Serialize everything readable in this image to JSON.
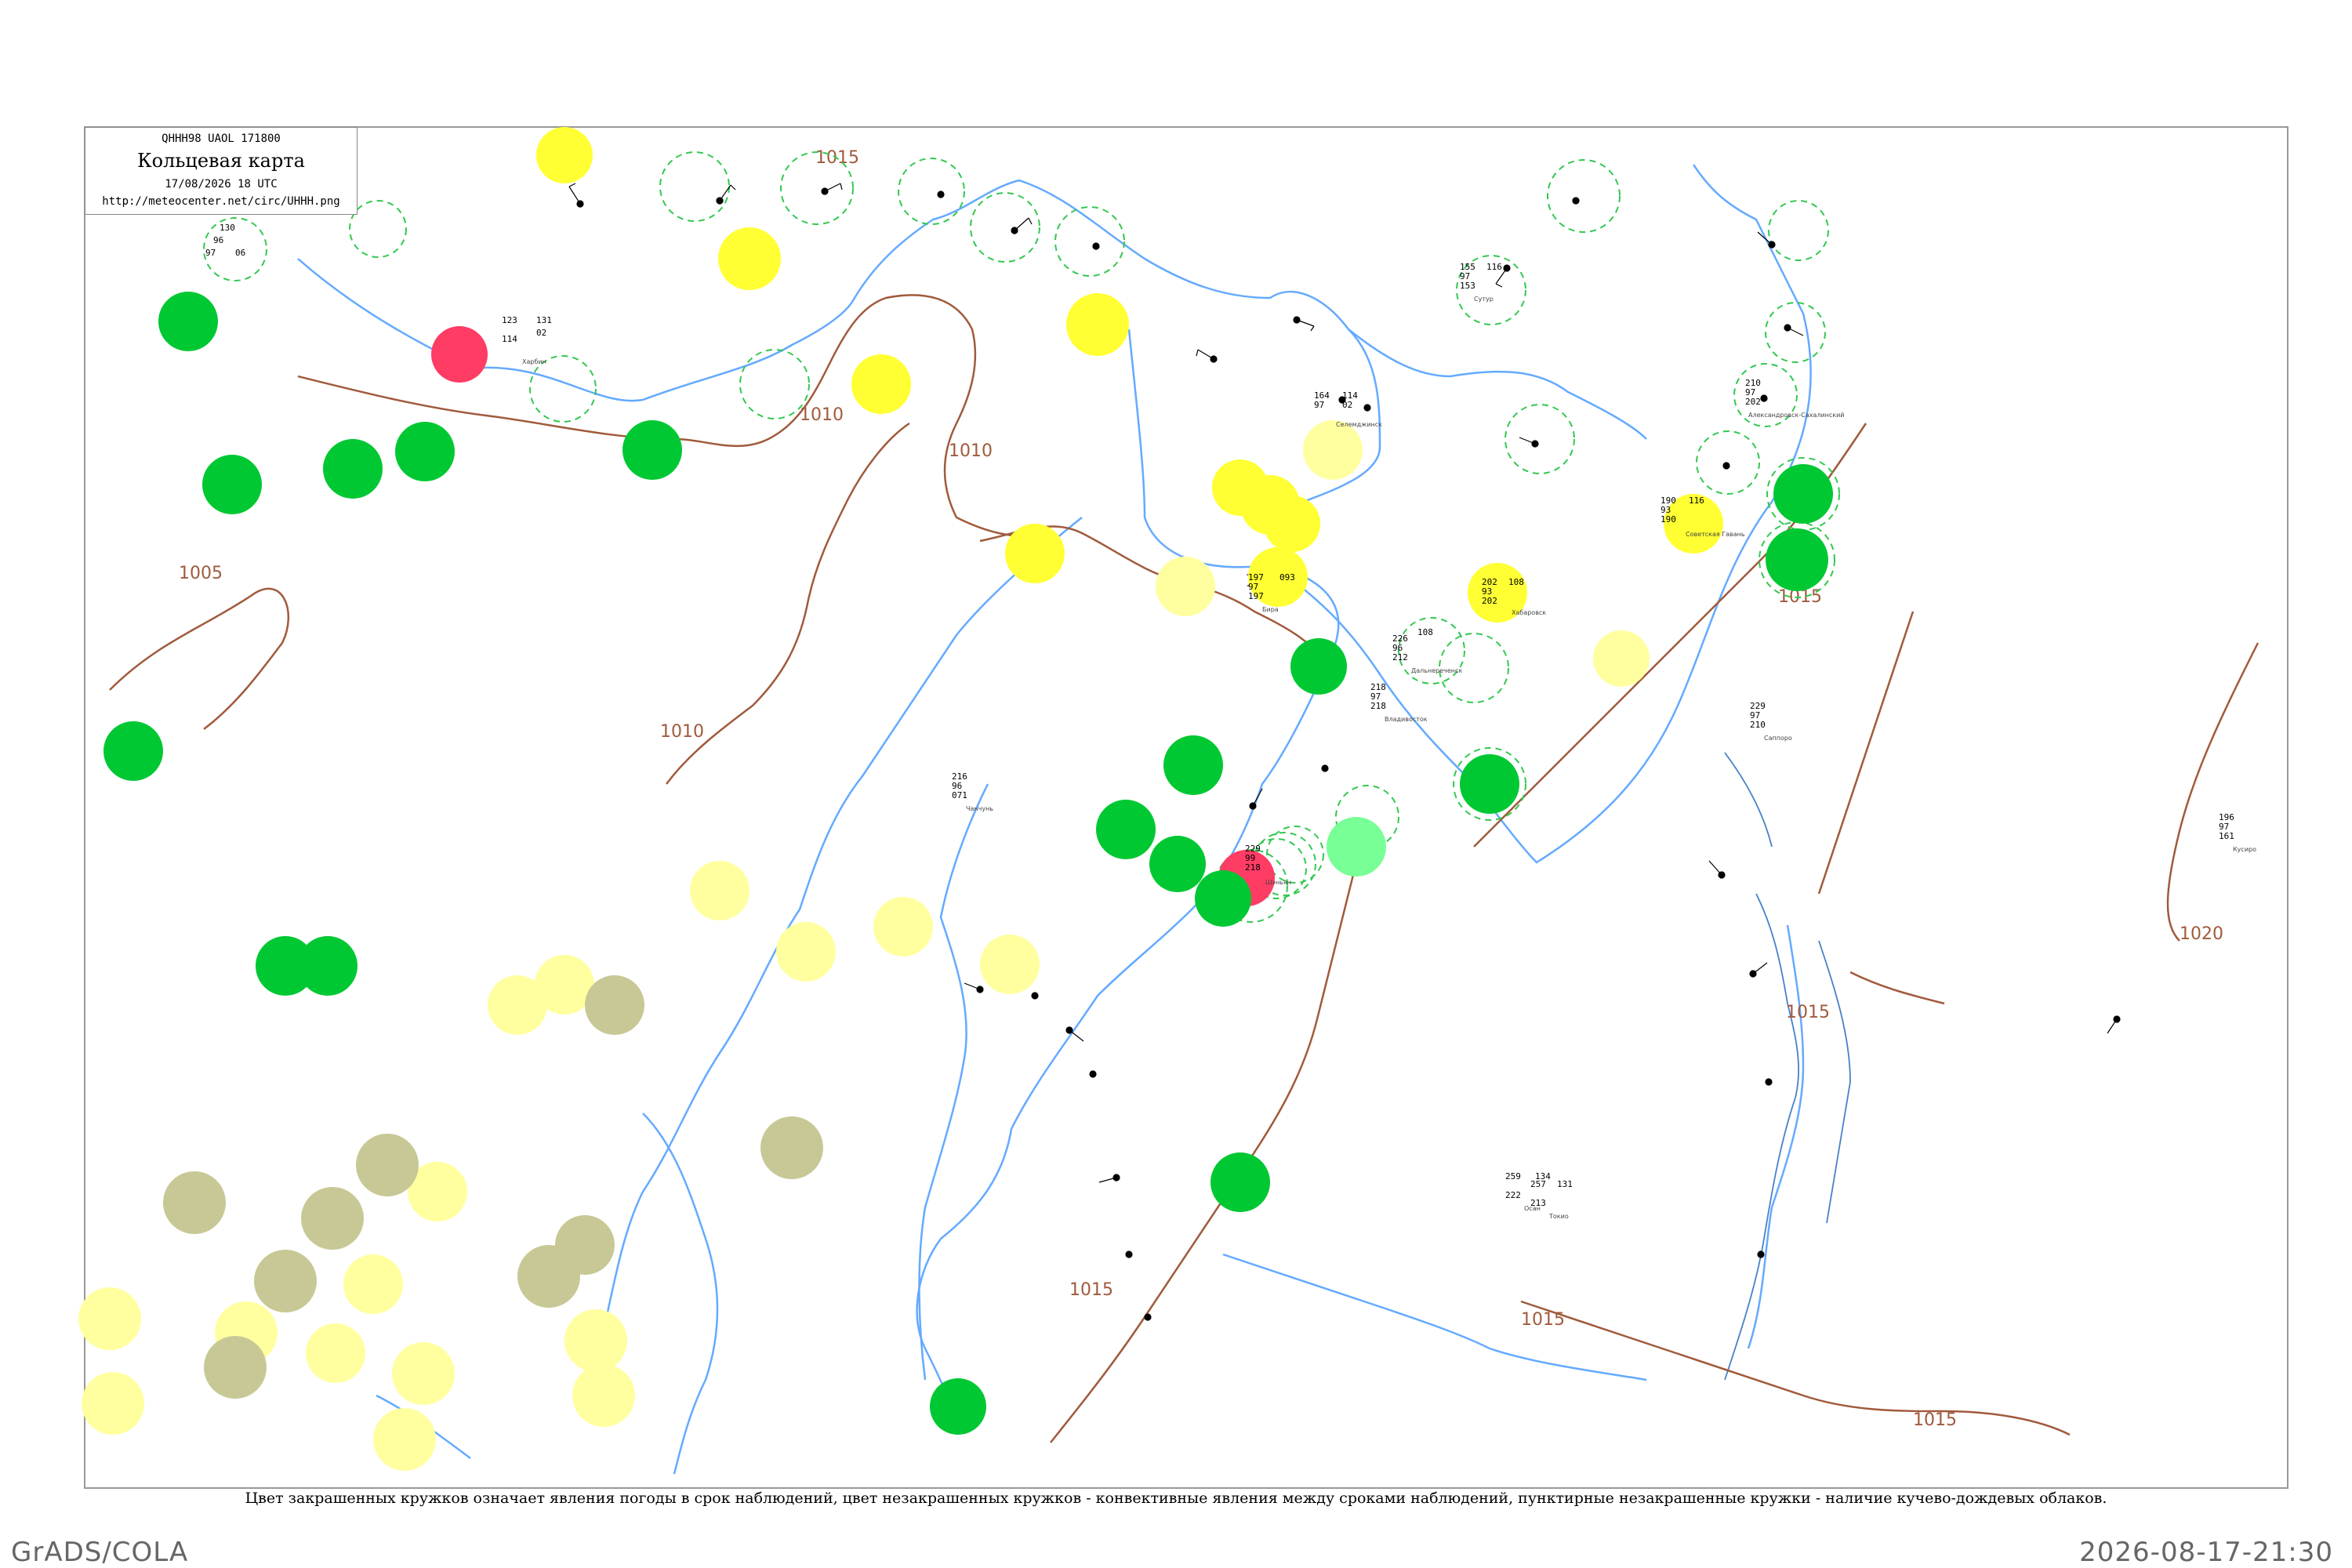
{
  "header": {
    "code": "QHHH98  UAOL  171800",
    "title": "Кольцевая карта",
    "date": "17/08/2026 18 UTC",
    "url": "http://meteocenter.net/circ/UHHH.png"
  },
  "caption": "Цвет закрашенных кружков означает явления погоды в срок наблюдений, цвет незакрашенных кружков - конвективные явления между сроками наблюдений, пунктирные незакрашенные кружки - наличие кучево-дождевых облаков.",
  "footer": {
    "left": "GrADS/COLA",
    "right": "2026-08-17-21:30"
  },
  "colors": {
    "green": "#00c832",
    "yellow": "#ffff33",
    "pale_yellow": "#ffffa0",
    "olive": "#c8c896",
    "red": "#ff3c64",
    "light_green": "#78ff96",
    "isobar": "#a05a3c",
    "river": "#64aaff",
    "dashed_circle": "#32c850"
  },
  "isobars": [
    "1015",
    "1010",
    "1010",
    "1010",
    "1005",
    "1010",
    "1015",
    "1020",
    "1015",
    "1015",
    "1015",
    "1015"
  ],
  "stations": [
    {
      "id": "50834",
      "name": "",
      "vals": [
        "130",
        "97",
        "96",
        "06"
      ]
    },
    {
      "id": "50953",
      "name": "Харбин",
      "vals": [
        "123",
        "114",
        "131",
        "02"
      ]
    },
    {
      "id": "31532",
      "name": "Селемджинск",
      "vals": [
        "164",
        "97",
        "114",
        "02"
      ]
    },
    {
      "id": "31707",
      "name": "Бира",
      "vals": [
        "197",
        "093",
        "97",
        "197"
      ]
    },
    {
      "id": "31735",
      "name": "Хабаровск",
      "vals": [
        "202",
        "93",
        "108",
        "202"
      ]
    },
    {
      "id": "31770",
      "name": "Советская Гавань",
      "vals": [
        "190",
        "93",
        "116",
        "190"
      ]
    },
    {
      "id": "32061",
      "name": "Александровск-Сахалинский",
      "vals": [
        "210",
        "97",
        "202"
      ]
    },
    {
      "id": "47412",
      "name": "Саппоро",
      "vals": [
        "229",
        "97",
        "210"
      ]
    },
    {
      "id": "54342",
      "name": "Шэньян",
      "vals": [
        "229",
        "99",
        "218"
      ]
    },
    {
      "id": "47122",
      "name": "Осан",
      "vals": [
        "259",
        "134",
        "222"
      ]
    },
    {
      "id": "47420",
      "name": "Кусиро",
      "vals": [
        "196",
        "97",
        "161"
      ]
    },
    {
      "id": "31538",
      "name": "Сутур",
      "vals": [
        "155",
        "116",
        "97",
        "153"
      ]
    },
    {
      "id": "31873",
      "name": "Дальнереченск",
      "vals": [
        "226",
        "108",
        "96",
        "212"
      ]
    },
    {
      "id": "31960",
      "name": "Владивосток",
      "vals": [
        "218",
        "97",
        "218"
      ]
    },
    {
      "id": "54161",
      "name": "Чанчунь",
      "vals": [
        "216",
        "96",
        "071"
      ]
    },
    {
      "id": "47669",
      "name": "Токио",
      "vals": [
        "257",
        "131",
        "213"
      ]
    }
  ],
  "legend_pressure_labels": [
    "1015",
    "1010",
    "1005",
    "1020"
  ]
}
